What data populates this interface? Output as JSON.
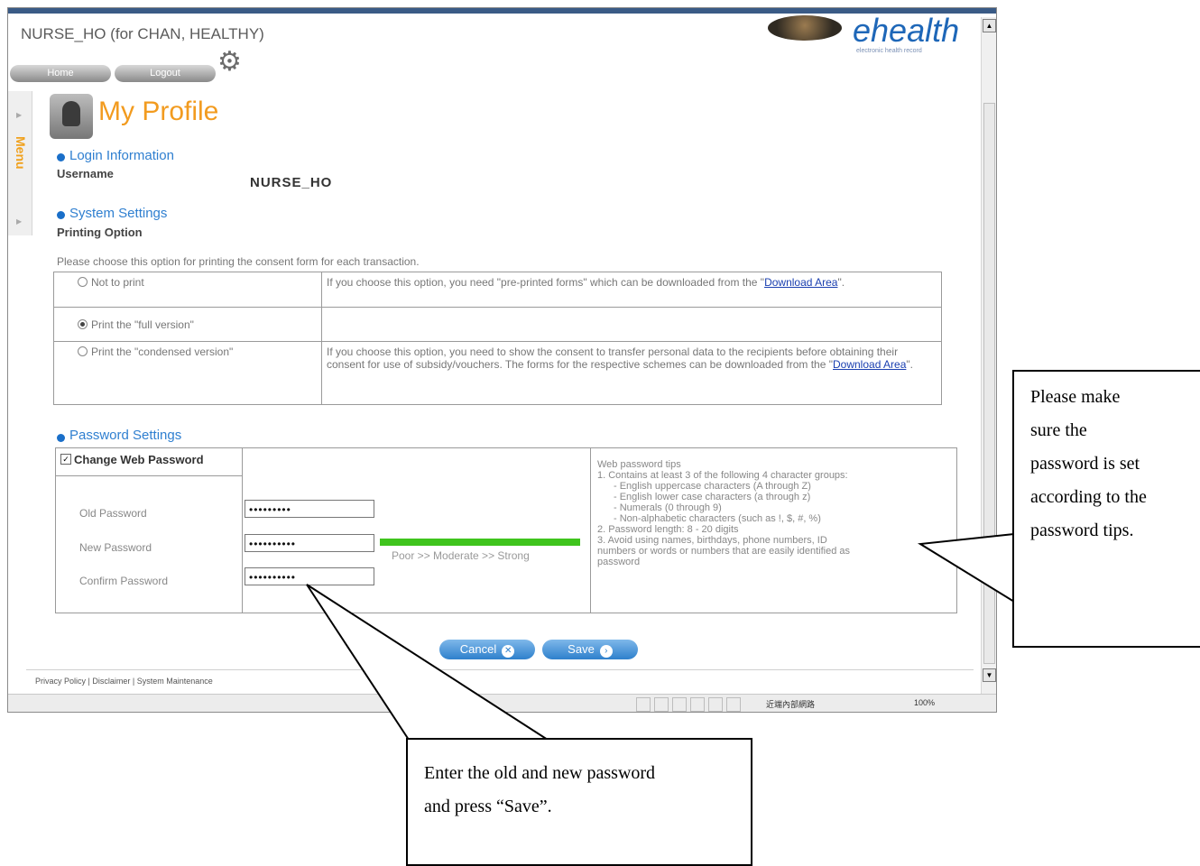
{
  "window": {
    "title": "NURSE_HO (for CHAN, HEALTHY)",
    "logo": "ehealth",
    "logo_sub": "electronic health record"
  },
  "nav": {
    "home": "Home",
    "logout": "Logout"
  },
  "menu_tab": "Menu",
  "page": {
    "title": "My Profile",
    "login_section": "Login Information",
    "username_label": "Username",
    "username_value": "NURSE_HO",
    "system_section": "System Settings",
    "printing_label": "Printing Option",
    "printing_note": "Please choose this option for printing the consent form for each transaction.",
    "options": [
      {
        "label": "Not to print",
        "selected": false,
        "desc_pre": "If you choose this option, you need \"pre-printed forms\" which can be downloaded from the \"",
        "link": "Download Area",
        "desc_post": "\"."
      },
      {
        "label": "Print the \"full version\"",
        "selected": true,
        "desc_pre": "",
        "link": "",
        "desc_post": ""
      },
      {
        "label": "Print the \"condensed version\"",
        "selected": false,
        "desc_pre": "If you choose this option, you need to show the consent to transfer personal data to the recipients before obtaining their consent for use of subsidy/vouchers. The forms for the respective schemes can be downloaded from the \"",
        "link": "Download Area",
        "desc_post": "\"."
      }
    ],
    "password_section": "Password Settings",
    "change_password_label": "Change Web Password",
    "old_password_label": "Old Password",
    "new_password_label": "New Password",
    "confirm_password_label": "Confirm Password",
    "old_password_value": "•••••••••",
    "new_password_value": "••••••••••",
    "confirm_password_value": "••••••••••",
    "strength_label": "Poor   >> Moderate >>  Strong",
    "strength_level": 1.0,
    "tips": [
      "Web password tips",
      "1. Contains at least 3 of the following 4 character groups:",
      "- English uppercase characters (A through Z)",
      "- English lower case characters (a through z)",
      "- Numerals (0 through 9)",
      "- Non-alphabetic characters (such as !, $, #, %)",
      "2. Password length: 8 - 20 digits",
      "3. Avoid using names, birthdays, phone numbers, ID",
      "numbers or words or numbers that are easily identified as",
      "password"
    ],
    "cancel_label": "Cancel",
    "save_label": "Save",
    "footer": "Privacy Policy | Disclaimer | System Maintenance"
  },
  "statusbar": {
    "zone": "近端內部網路",
    "zoom": "100%"
  },
  "callouts": {
    "right": [
      "Please make",
      "sure the",
      "password is set",
      "according to the",
      "password tips."
    ],
    "bottom": [
      "Enter the old and new password",
      "and press “Save”."
    ]
  },
  "colors": {
    "accent_orange": "#f29b1f",
    "section_blue": "#2f7fd0",
    "strength_green": "#3fc41d",
    "button_blue": "#2e80cc"
  }
}
